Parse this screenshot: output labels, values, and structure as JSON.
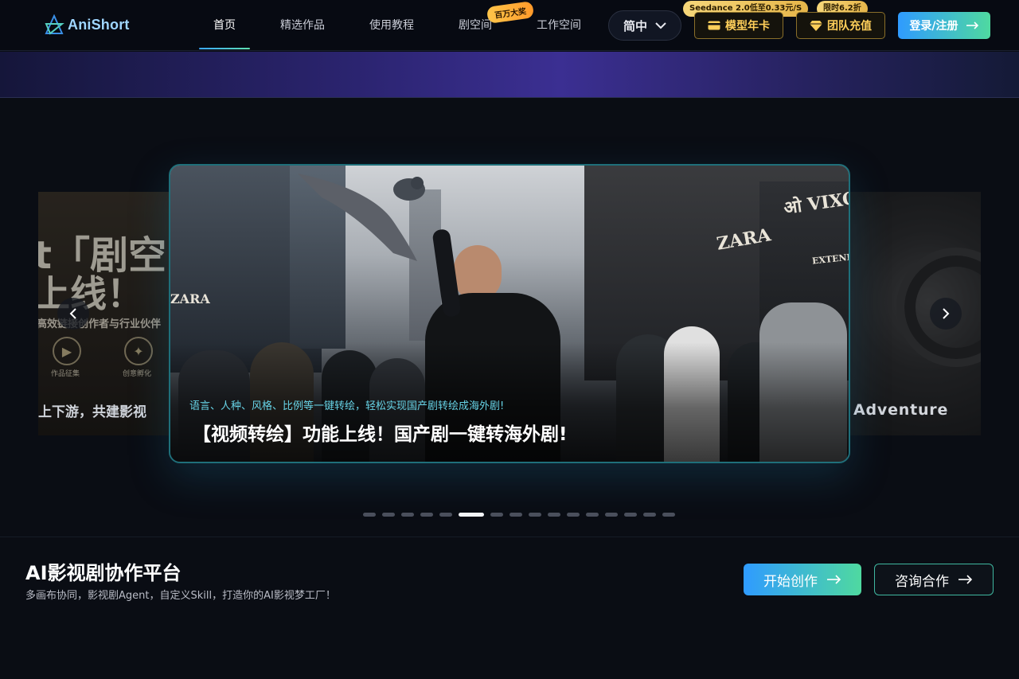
{
  "header": {
    "logo_text": "AniShort",
    "nav": [
      {
        "label": "首页",
        "active": true
      },
      {
        "label": "精选作品",
        "active": false
      },
      {
        "label": "使用教程",
        "active": false
      },
      {
        "label": "剧空间",
        "active": false
      },
      {
        "label": "工作空间",
        "active": false
      }
    ],
    "nav_badge": "百万大奖",
    "language": "简中",
    "model_card": {
      "label": "模型年卡",
      "tag": "Seedance 2.0低至0.33元/S"
    },
    "team_recharge": {
      "label": "团队充值",
      "tag": "限时6.2折"
    },
    "login_label": "登录/注册"
  },
  "carousel": {
    "left_card": {
      "big_line1": "t「剧空间",
      "big_line2": "上线！",
      "small_line": "高效链接创作者与行业伙伴",
      "icon1_label": "作品征集",
      "icon2_label": "创意孵化",
      "bottom_text": "上下游，共建影视"
    },
    "main": {
      "subtitle": "语言、人种、风格、比例等一键转绘，轻松实现国产剧转绘成海外剧!",
      "title": "【视频转绘】功能上线！国产剧一键转海外剧!",
      "sign_left": "ZARA",
      "sign_mid": "ZARA",
      "sign_right": "ओ VIXOO",
      "sign_right2": "EXTENDRA"
    },
    "right_card": {
      "title": "Adventure"
    },
    "slide_count": 16,
    "active_index": 5
  },
  "bottom": {
    "title": "AI影视剧协作平台",
    "subtitle": "多画布协同，影视剧Agent，自定义Skill，打造你的AI影视梦工厂！",
    "start_label": "开始创作",
    "consult_label": "咨询合作"
  },
  "colors": {
    "accent_start": "#2f9bff",
    "accent_end": "#4fd9a0",
    "gold": "#ffcf5a",
    "subtitle_cyan": "#67d3e6"
  }
}
